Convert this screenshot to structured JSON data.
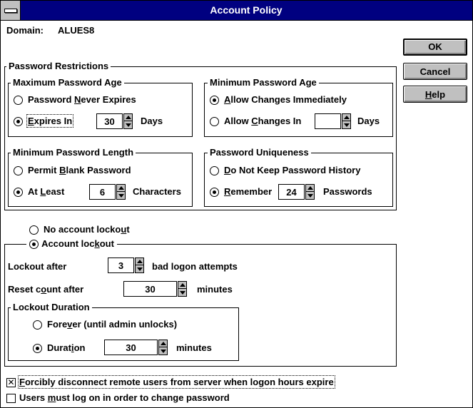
{
  "window": {
    "title": "Account Policy"
  },
  "domain": {
    "label": "Domain:",
    "value": "ALUES8"
  },
  "buttons": {
    "ok": "OK",
    "cancel": "Cancel",
    "help_pre": "",
    "help_u": "H",
    "help_post": "elp"
  },
  "password_restrictions": {
    "title": "Password Restrictions",
    "max_age": {
      "title": "Maximum Password Age",
      "never": {
        "pre": "Password ",
        "u": "N",
        "post": "ever Expires",
        "selected": false
      },
      "expires": {
        "pre": "",
        "u": "E",
        "post": "xpires In",
        "value": "30",
        "suffix": "Days",
        "selected": true
      }
    },
    "min_age": {
      "title": "Minimum Password Age",
      "immediate": {
        "pre": "",
        "u": "A",
        "post": "llow Changes Immediately",
        "selected": true
      },
      "allow_in": {
        "pre": "Allow ",
        "u": "C",
        "post": "hanges In",
        "value": "",
        "suffix": "Days",
        "selected": false
      }
    },
    "min_length": {
      "title": "Minimum Password Length",
      "blank": {
        "pre": "Permit ",
        "u": "B",
        "post": "lank Password",
        "selected": false
      },
      "at_least": {
        "pre": "At ",
        "u": "L",
        "post": "east",
        "value": "6",
        "suffix": "Characters",
        "selected": true
      }
    },
    "uniqueness": {
      "title": "Password Uniqueness",
      "no_history": {
        "pre": "",
        "u": "D",
        "post": "o Not Keep Password History",
        "selected": false
      },
      "remember": {
        "pre": "",
        "u": "R",
        "post": "emember",
        "value": "24",
        "suffix": "Passwords",
        "selected": true
      }
    }
  },
  "lockout": {
    "no_lockout": {
      "pre": "No account locko",
      "u": "u",
      "post": "t",
      "selected": false
    },
    "account_lockout": {
      "pre": "Account loc",
      "u": "k",
      "post": "out",
      "selected": true
    },
    "after": {
      "label": "Lockout after",
      "value": "3",
      "suffix_pre": "bad lo",
      "suffix_u": "g",
      "suffix_post": "on attempts"
    },
    "reset": {
      "label_pre": "Reset c",
      "label_u": "o",
      "label_post": "unt after",
      "value": "30",
      "suffix": "minutes"
    },
    "duration": {
      "title": "Lockout Duration",
      "forever": {
        "pre": "Fore",
        "u": "v",
        "post": "er (until admin unlocks)",
        "selected": false
      },
      "timed": {
        "pre": "Durat",
        "u": "i",
        "post": "on",
        "value": "30",
        "suffix": "minutes",
        "selected": true
      }
    }
  },
  "options": {
    "disconnect": {
      "pre": "",
      "u": "F",
      "post": "orcibly disconnect remote users from server when logon hours expire",
      "checked": true
    },
    "must_logon": {
      "pre": "Users ",
      "u": "m",
      "post": "ust log on in order to change password",
      "checked": false
    }
  }
}
